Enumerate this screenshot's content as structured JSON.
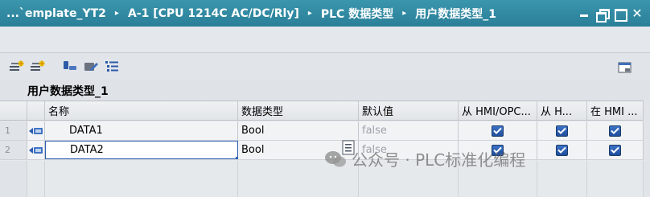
{
  "titlebar": {
    "breadcrumbs": [
      "...`emplate_YT2",
      "A-1 [CPU 1214C AC/DC/Rly]",
      "PLC 数据类型",
      "用户数据类型_1"
    ],
    "separator": "▸"
  },
  "toolbar": {
    "icons": [
      "insert-row-icon",
      "add-row-icon",
      "move-icon",
      "edit-icon",
      "list-icon",
      "window-icon"
    ]
  },
  "datatype_title": "用户数据类型_1",
  "table": {
    "columns": [
      "名称",
      "数据类型",
      "默认值",
      "从 HMI/OPC...",
      "从 H...",
      "在 HMI ..."
    ],
    "rows": [
      {
        "num": "1",
        "name": "DATA1",
        "type": "Bool",
        "default": "false",
        "hmi_access": true,
        "hmi_write": true,
        "hmi_visible": true
      },
      {
        "num": "2",
        "name": "DATA2",
        "type": "Bool",
        "default": "false",
        "hmi_access": true,
        "hmi_write": true,
        "hmi_visible": true
      }
    ]
  },
  "watermark": "公众号 · PLC标准化编程",
  "colors": {
    "titlebar": "#2f88a1",
    "checkbox": "#2a5db0",
    "background": "#dfe3e8"
  }
}
